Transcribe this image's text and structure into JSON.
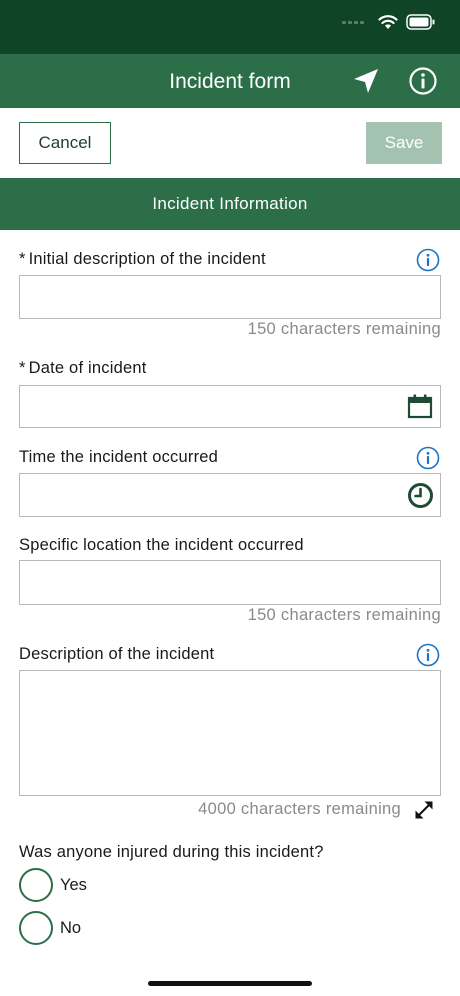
{
  "app_bar": {
    "title": "Incident form"
  },
  "toolbar": {
    "cancel_label": "Cancel",
    "save_label": "Save"
  },
  "section": {
    "title": "Incident Information"
  },
  "fields": {
    "initial_description": {
      "required_marker": "*",
      "label": "Initial description of the incident",
      "value": "",
      "counter": "150 characters remaining"
    },
    "date": {
      "required_marker": "*",
      "label": "Date of incident",
      "value": ""
    },
    "time": {
      "label": "Time the incident occurred",
      "value": ""
    },
    "location": {
      "label": "Specific location the incident occurred",
      "value": "",
      "counter": "150 characters remaining"
    },
    "description": {
      "label": "Description of the incident",
      "value": "",
      "counter": "4000 characters remaining"
    }
  },
  "injury_question": {
    "label": "Was anyone injured during this incident?",
    "options": [
      "Yes",
      "No"
    ]
  },
  "colors": {
    "status_bar": "#0f4427",
    "primary": "#2c6e48",
    "save_disabled": "#a3c2b0",
    "info_blue": "#1a73c6",
    "counter_gray": "#8a8a8a"
  },
  "icons": {
    "status": [
      "wifi-icon",
      "battery-icon"
    ],
    "nav": [
      "location-arrow-icon",
      "info-icon"
    ],
    "fields": [
      "calendar-icon",
      "clock-icon",
      "expand-icon"
    ]
  }
}
